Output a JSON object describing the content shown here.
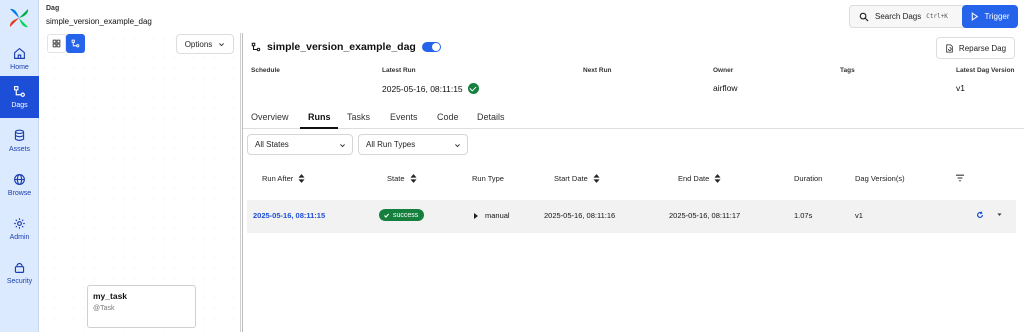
{
  "nav": {
    "items": [
      {
        "label": "Home",
        "icon": "home-icon"
      },
      {
        "label": "Dags",
        "icon": "dags-icon",
        "active": true
      },
      {
        "label": "Assets",
        "icon": "assets-icon"
      },
      {
        "label": "Browse",
        "icon": "globe-icon"
      },
      {
        "label": "Admin",
        "icon": "gear-icon"
      },
      {
        "label": "Security",
        "icon": "lock-icon"
      }
    ]
  },
  "header": {
    "breadcrumb_label": "Dag",
    "breadcrumb_value": "simple_version_example_dag",
    "search_label": "Search Dags",
    "search_shortcut": "Ctrl+K",
    "trigger_label": "Trigger"
  },
  "graph_panel": {
    "options_label": "Options",
    "task": {
      "name": "my_task",
      "type": "@Task"
    }
  },
  "dag": {
    "title": "simple_version_example_dag",
    "paused": false,
    "reparse_label": "Reparse Dag",
    "meta": {
      "schedule_label": "Schedule",
      "schedule_value": "",
      "latest_run_label": "Latest Run",
      "latest_run_value": "2025-05-16, 08:11:15",
      "next_run_label": "Next Run",
      "next_run_value": "",
      "owner_label": "Owner",
      "owner_value": "airflow",
      "tags_label": "Tags",
      "tags_value": "",
      "version_label": "Latest Dag Version",
      "version_value": "v1"
    }
  },
  "tabs": [
    "Overview",
    "Runs",
    "Tasks",
    "Events",
    "Code",
    "Details"
  ],
  "active_tab": "Runs",
  "filters": {
    "state_value": "All States",
    "run_type_value": "All Run Types"
  },
  "table": {
    "columns": [
      "Run After",
      "State",
      "Run Type",
      "Start Date",
      "End Date",
      "Duration",
      "Dag Version(s)"
    ],
    "rows": [
      {
        "run_after": "2025-05-16, 08:11:15",
        "state": "success",
        "run_type": "manual",
        "start_date": "2025-05-16, 08:11:16",
        "end_date": "2025-05-16, 08:11:17",
        "duration": "1.07s",
        "dag_version": "v1"
      }
    ]
  },
  "colors": {
    "accent": "#2563eb",
    "nav_bg": "#dbeafe",
    "success": "#15803d"
  }
}
